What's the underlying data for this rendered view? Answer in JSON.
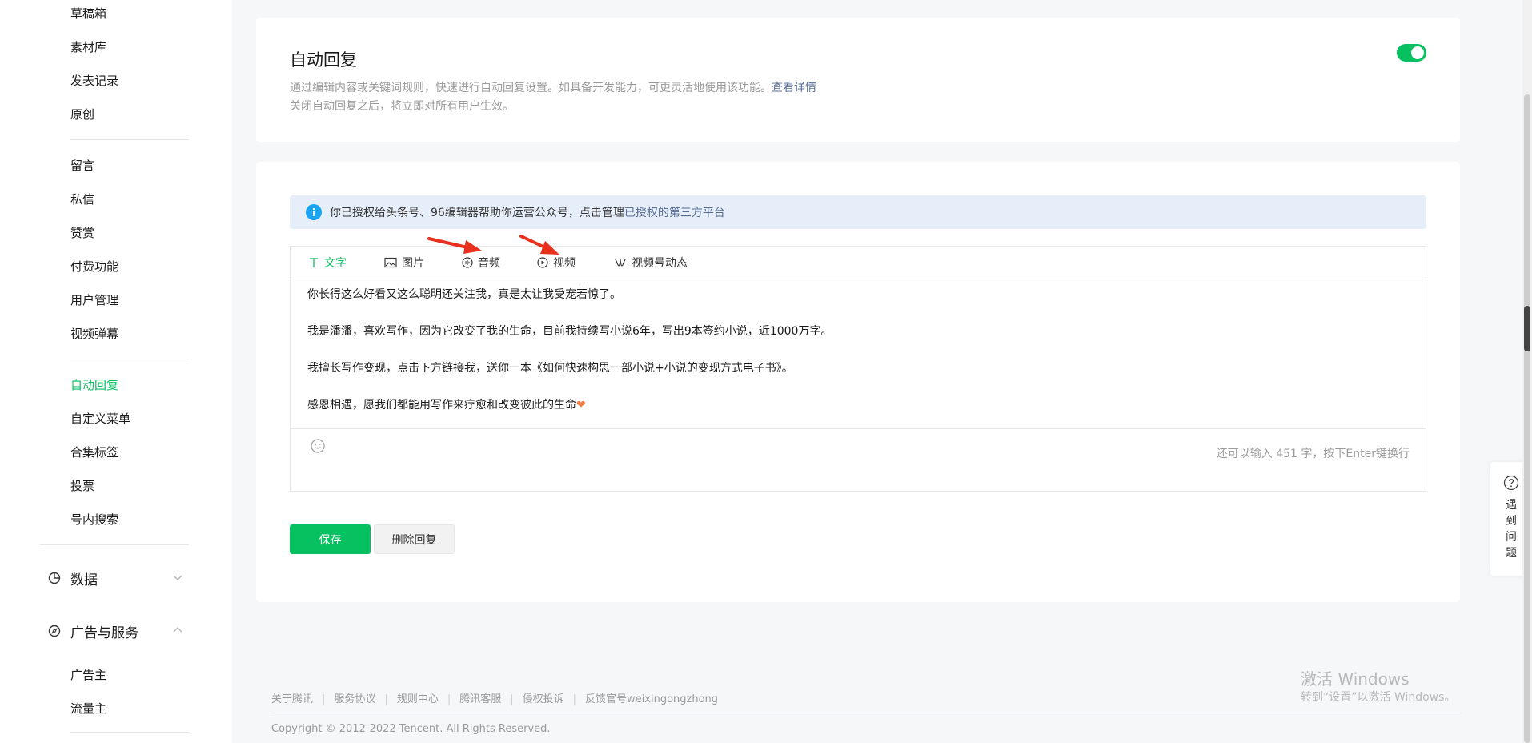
{
  "sidebar": {
    "group1": [
      "草稿箱",
      "素材库",
      "发表记录",
      "原创"
    ],
    "group2": [
      "留言",
      "私信",
      "赞赏",
      "付费功能",
      "用户管理",
      "视频弹幕"
    ],
    "group3": [
      "自动回复",
      "自定义菜单",
      "合集标签",
      "投票",
      "号内搜索"
    ],
    "active_item": "自动回复",
    "sections": [
      {
        "label": "数据",
        "icon": "pie-chart-icon",
        "expanded": false
      },
      {
        "label": "广告与服务",
        "icon": "compass-icon",
        "expanded": true
      }
    ],
    "ad_items": [
      "广告主",
      "流量主"
    ]
  },
  "auto_reply": {
    "title": "自动回复",
    "desc_line1": "通过编辑内容或关键词规则，快速进行自动回复设置。如具备开发能力，可更灵活地使用该功能。",
    "details_link": "查看详情",
    "desc_line2": "关闭自动回复之后，将立即对所有用户生效。",
    "enabled": true
  },
  "notice": {
    "text": "你已授权给头条号、96编辑器帮助你运营公众号，点击管理",
    "link": "已授权的第三方平台"
  },
  "editor": {
    "tabs": [
      {
        "label": "文字",
        "icon": "text-icon",
        "active": true
      },
      {
        "label": "图片",
        "icon": "image-icon",
        "active": false
      },
      {
        "label": "音频",
        "icon": "audio-icon",
        "active": false
      },
      {
        "label": "视频",
        "icon": "video-icon",
        "active": false
      },
      {
        "label": "视频号动态",
        "icon": "channels-icon",
        "active": false
      }
    ],
    "paragraphs": [
      "你长得这么好看又这么聪明还关注我，真是太让我受宠若惊了。",
      "我是潘潘，喜欢写作，因为它改变了我的生命，目前我持续写小说6年，写出9本签约小说，近1000万字。",
      "我擅长写作变现，点击下方链接我，送你一本《如何快速构思一部小说+小说的变现方式电子书》。",
      "感恩相遇，愿我们都能用写作来疗愈和改变彼此的生命"
    ],
    "heart": "❤",
    "counter": "还可以输入 451 字，按下Enter键换行"
  },
  "buttons": {
    "save": "保存",
    "delete": "删除回复"
  },
  "footer": {
    "links": [
      "关于腾讯",
      "服务协议",
      "规则中心",
      "腾讯客服",
      "侵权投诉",
      "反馈官号weixingongzhong"
    ],
    "copyright": "Copyright © 2012-2022 Tencent. All Rights Reserved."
  },
  "watermark": {
    "line1": "激活 Windows",
    "line2": "转到“设置”以激活 Windows。"
  },
  "help": {
    "label": "遇到问题"
  },
  "colors": {
    "accent": "#07c160",
    "link": "#576b95",
    "annotation_arrow": "#e8301c"
  }
}
